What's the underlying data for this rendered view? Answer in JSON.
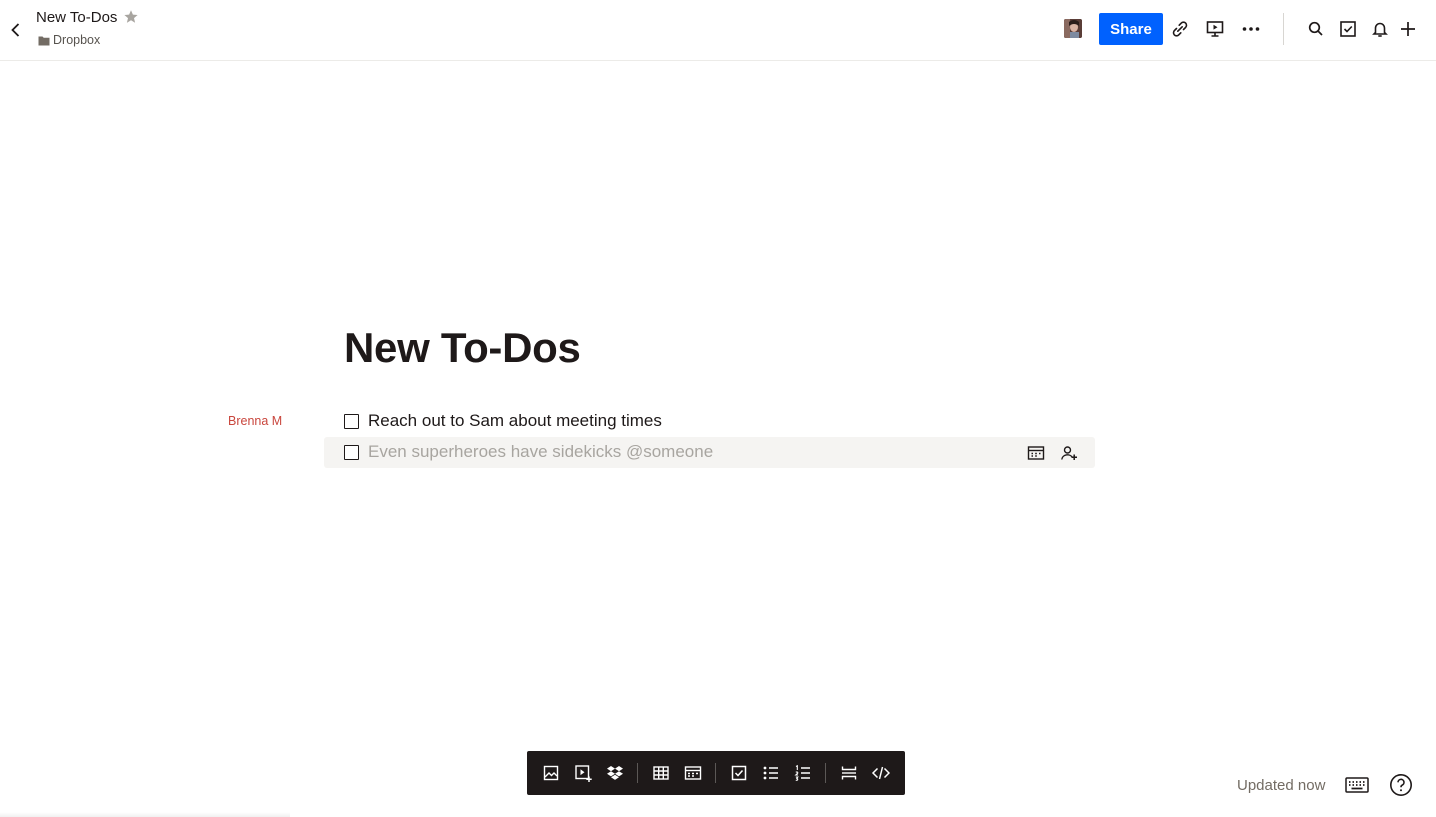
{
  "header": {
    "title": "New To-Dos",
    "folder": "Dropbox",
    "share_label": "Share"
  },
  "document": {
    "title": "New To-Dos",
    "author_label": "Brenna M",
    "todos": [
      {
        "text": "Reach out to Sam about meeting times",
        "checked": false
      }
    ],
    "new_todo_placeholder": "Even superheroes have sidekicks @someone"
  },
  "status": {
    "updated": "Updated now"
  },
  "colors": {
    "accent": "#0061fe",
    "author": "#c9463d",
    "toolbar_bg": "#1e1919"
  },
  "icons": {
    "header": [
      "back-icon",
      "star-icon",
      "folder-icon",
      "link-icon",
      "present-icon",
      "more-icon",
      "search-icon",
      "task-icon",
      "bell-icon",
      "plus-icon"
    ],
    "row": [
      "calendar-icon",
      "assign-person-icon"
    ],
    "toolbar": [
      "image-icon",
      "video-icon",
      "dropbox-icon",
      "table-icon",
      "timeline-icon",
      "checklist-icon",
      "bullet-list-icon",
      "numbered-list-icon",
      "divider-icon",
      "code-icon"
    ],
    "footer": [
      "keyboard-icon",
      "help-icon"
    ]
  }
}
